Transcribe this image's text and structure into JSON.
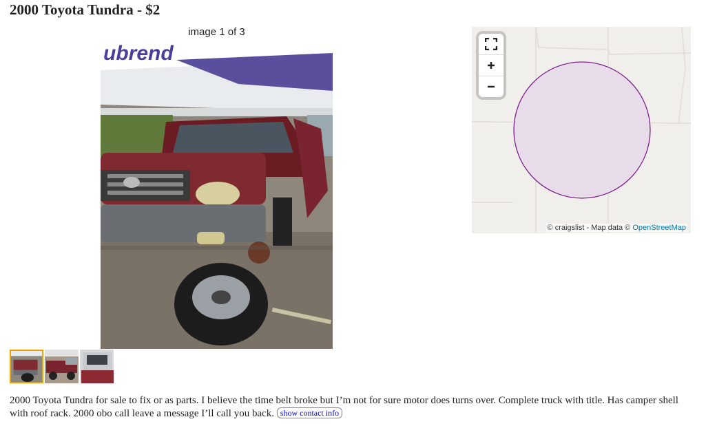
{
  "posting": {
    "title": "2000 Toyota Tundra - $2",
    "description": "2000 Toyota Tundra for sale to fix or as parts. I believe the time belt broke but I’m not for sure motor does turns over. Complete truck with title. Has camper shell with roof rack. 2000 obo call leave a message I’ll call you back.",
    "contact_button": "show contact info"
  },
  "gallery": {
    "counter": "image 1 of 3",
    "thumbnails": [
      {
        "selected": true
      },
      {
        "selected": false
      },
      {
        "selected": false
      }
    ]
  },
  "map": {
    "attribution_prefix": "© craigslist - Map data ©",
    "attribution_link": "OpenStreetMap",
    "controls": [
      "fullscreen-icon",
      "zoom-in-icon",
      "zoom-out-icon"
    ],
    "area_fill": "#e8dcea",
    "area_stroke": "#7b1f8c"
  }
}
